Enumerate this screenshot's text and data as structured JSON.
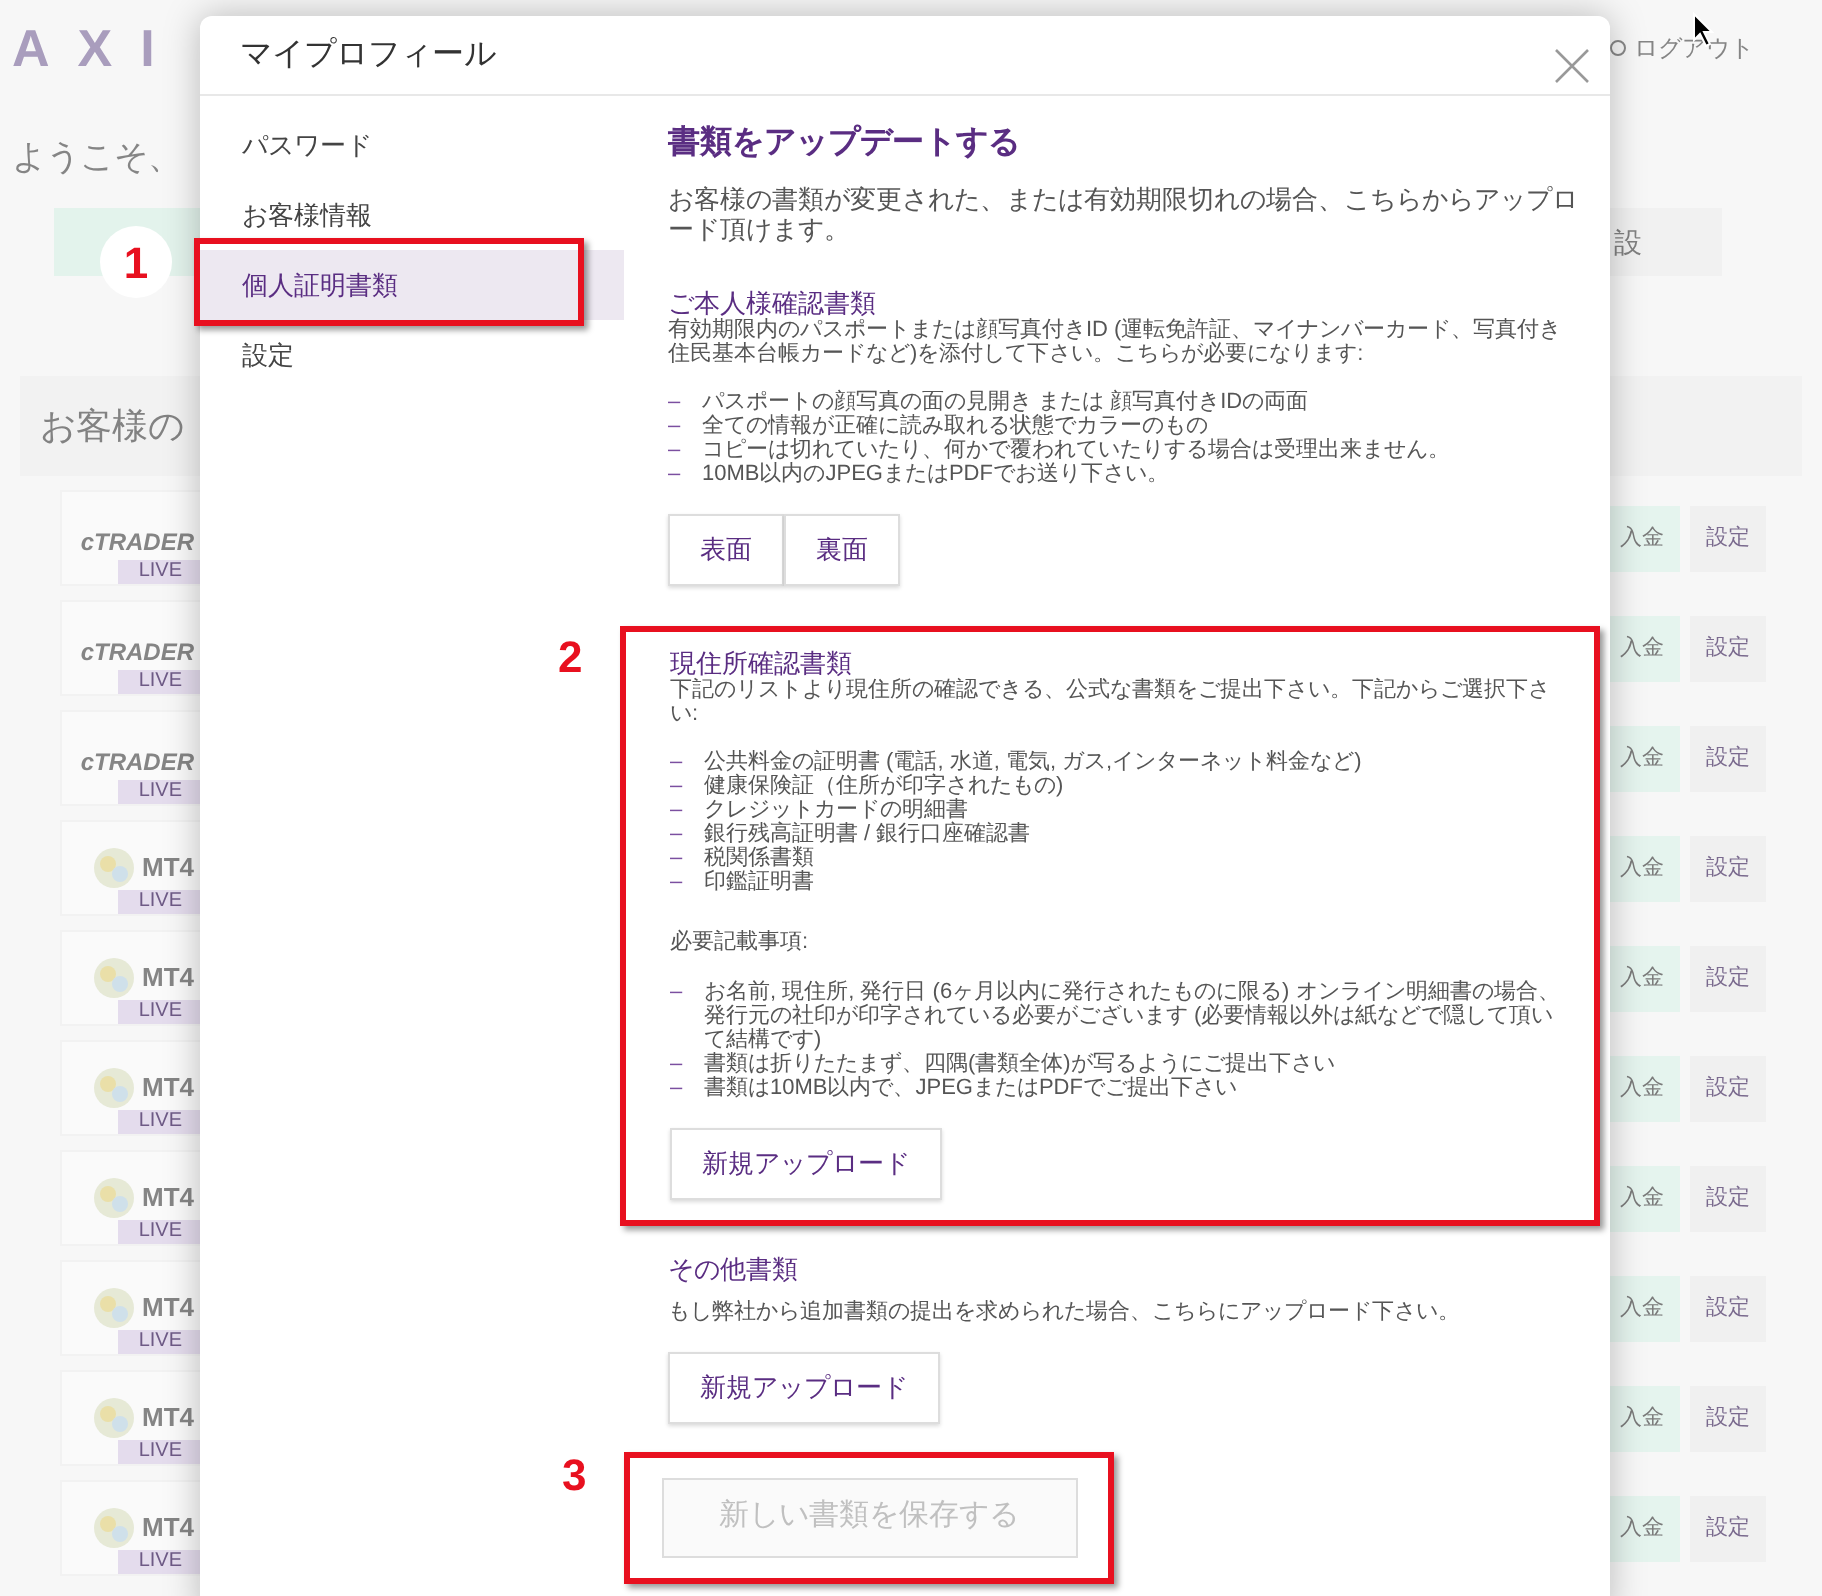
{
  "background": {
    "logo": "AXI",
    "logout": "ログアウト",
    "welcome": "ようこそ、",
    "top_button": "設",
    "section_title": "お客様の",
    "accounts": [
      {
        "kind": "ctrader",
        "logo": "cTRADER",
        "badge": "LIVE",
        "deposit": "入金",
        "settings": "設定"
      },
      {
        "kind": "ctrader",
        "logo": "cTRADER",
        "badge": "LIVE",
        "deposit": "入金",
        "settings": "設定"
      },
      {
        "kind": "ctrader",
        "logo": "cTRADER",
        "badge": "LIVE",
        "deposit": "入金",
        "settings": "設定"
      },
      {
        "kind": "mt4",
        "logo": "MT4",
        "badge": "LIVE",
        "deposit": "入金",
        "settings": "設定"
      },
      {
        "kind": "mt4",
        "logo": "MT4",
        "badge": "LIVE",
        "deposit": "入金",
        "settings": "設定"
      },
      {
        "kind": "mt4",
        "logo": "MT4",
        "badge": "LIVE",
        "deposit": "入金",
        "settings": "設定"
      },
      {
        "kind": "mt4",
        "logo": "MT4",
        "badge": "LIVE",
        "deposit": "入金",
        "settings": "設定"
      },
      {
        "kind": "mt4",
        "logo": "MT4",
        "badge": "LIVE",
        "deposit": "入金",
        "settings": "設定"
      },
      {
        "kind": "mt4",
        "logo": "MT4",
        "badge": "LIVE",
        "deposit": "入金",
        "settings": "設定"
      },
      {
        "kind": "mt4",
        "logo": "MT4",
        "badge": "LIVE",
        "deposit": "入金",
        "settings": "設定"
      }
    ]
  },
  "modal": {
    "title": "マイプロフィール",
    "sidebar": {
      "items": [
        {
          "label": "パスワード",
          "selected": false
        },
        {
          "label": "お客様情報",
          "selected": false
        },
        {
          "label": "個人証明書類",
          "selected": true
        },
        {
          "label": "設定",
          "selected": false
        }
      ]
    },
    "heading": "書類をアップデートする",
    "intro": "お客様の書類が変更された、または有効期限切れの場合、こちらからアップロード頂けます。",
    "sections": [
      {
        "title": "ご本人様確認書類",
        "text": "有効期限内のパスポートまたは顔写真付きID (運転免許証、マイナンバーカード、写真付き住民基本台帳カードなど)を添付して下さい。こちらが必要になります:",
        "bullets": [
          {
            "mark": "–",
            "text": "パスポートの顔写真の面の見開き または 顔写真付きIDの両面"
          },
          {
            "mark": "–",
            "text": "全ての情報が正確に読み取れる状態でカラーのもの"
          },
          {
            "mark": "–",
            "text": "コピーは切れていたり、何かで覆われていたりする場合は受理出来ません。"
          },
          {
            "mark": "–",
            "text": "10MB以内のJPEGまたはPDFでお送り下さい。"
          }
        ],
        "buttons": [
          "表面",
          "裏面"
        ]
      },
      {
        "title": "現住所確認書類",
        "text": "下記のリストより現住所の確認できる、公式な書類をご提出下さい。下記からご選択下さい:",
        "bullets": [
          {
            "mark": "–",
            "text": "公共料金の証明書 (電話, 水道, 電気, ガス,インターネット料金など)"
          },
          {
            "mark": "–",
            "text": "健康保険証（住所が印字されたもの)"
          },
          {
            "mark": "–",
            "text": "クレジットカードの明細書"
          },
          {
            "mark": "–",
            "text": "銀行残高証明書 / 銀行口座確認書"
          },
          {
            "mark": "–",
            "text": "税関係書類"
          },
          {
            "mark": "–",
            "text": "印鑑証明書"
          }
        ],
        "note_title": "必要記載事項:",
        "note_bullets": [
          {
            "mark": "–",
            "text": "お名前, 現住所, 発行日 (6ヶ月以内に発行されたものに限る) オンライン明細書の場合、発行元の社印が印字されている必要がございます (必要情報以外は紙などで隠して頂いて結構です)"
          },
          {
            "mark": "–",
            "text": "書類は折りたたまず、四隅(書類全体)が写るようにご提出下さい"
          },
          {
            "mark": "–",
            "text": "書類は10MB以内で、JPEGまたはPDFでご提出下さい"
          }
        ],
        "buttons": [
          "新規アップロード"
        ]
      },
      {
        "title": "その他書類",
        "text": "もし弊社から追加書類の提出を求められた場合、こちらにアップロード下さい。",
        "buttons": [
          "新規アップロード"
        ]
      }
    ],
    "save_button": {
      "label": "新しい書類を保存する",
      "disabled": true
    }
  },
  "annotations": [
    {
      "label": "1"
    },
    {
      "label": "2"
    },
    {
      "label": "3"
    }
  ]
}
